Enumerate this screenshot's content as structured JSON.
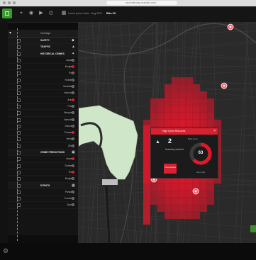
{
  "browser": {
    "url": "my.centermap.example.com/..."
  },
  "toolbar": {
    "breadcrumb": "Lorem ipsum dolor · Aug 2021",
    "title": "Bike-Fit"
  },
  "panel": {
    "header": "Overlays",
    "groups": [
      {
        "label": "SAFETY",
        "icon": "shield-icon",
        "items": []
      },
      {
        "label": "TRAFFIC",
        "icon": "warning-icon",
        "items": []
      },
      {
        "label": "HISTORICAL CRIMES",
        "icon": "pin-icon",
        "items": [
          "Assault",
          "Burglary",
          "Theft",
          "Robbery",
          "Vandalism",
          "Homicide",
          "Arson",
          "Fraud",
          "Weapons",
          "Narcotics",
          "Disorder",
          "Trespass",
          "Vehicle",
          "Other"
        ]
      },
      {
        "label": "CRIME PREDICTIONS",
        "icon": "chart-icon",
        "items": [
          "Assault",
          "Robbery",
          "Theft",
          "Burglary"
        ]
      },
      {
        "label": "EVENTS",
        "icon": "calendar-icon",
        "items": [
          "Parades",
          "Concerts",
          "Sports"
        ]
      }
    ]
  },
  "popup": {
    "title": "High Crime Risk Area",
    "count": "2",
    "subtitle": "Assaults predicted",
    "button": "View details",
    "gauge_label": "Risk score",
    "gauge_value": "63",
    "gauge_fraction": 0.63,
    "gauge_footer": "Very high"
  },
  "colors": {
    "accent_green": "#3a9b2d",
    "risk_red": "#e0182c",
    "park_green": "#cfe6c8"
  }
}
